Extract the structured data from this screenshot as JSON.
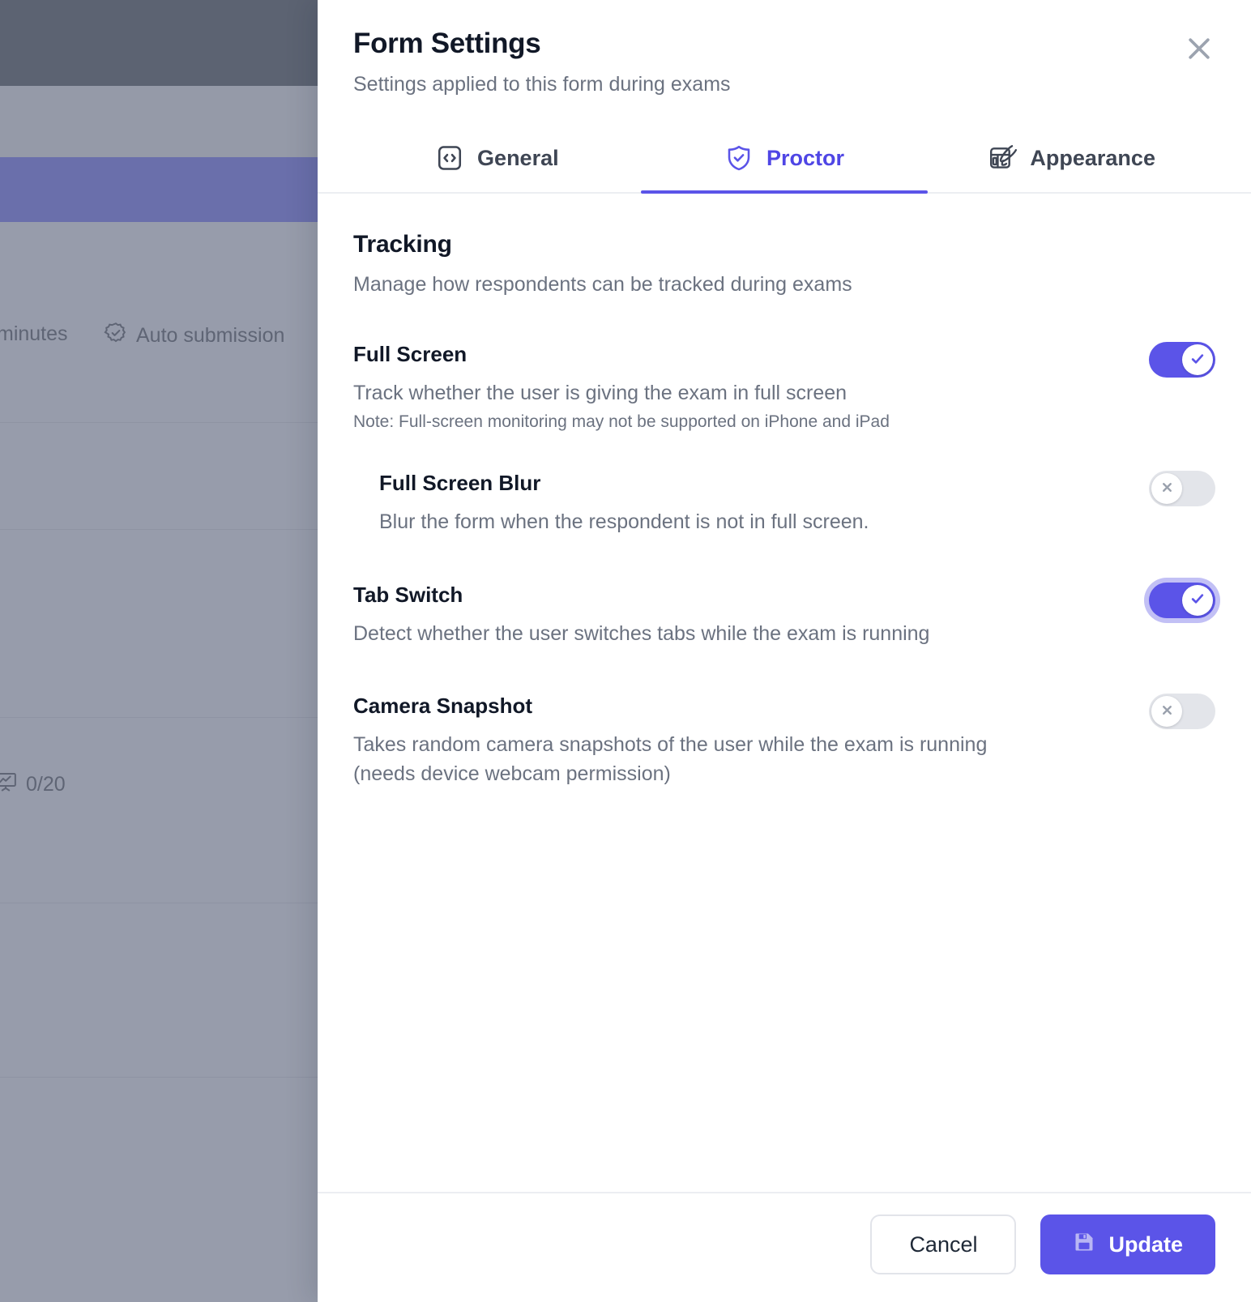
{
  "background": {
    "timer_text": "minutes",
    "auto_submission_label": "Auto submission",
    "auto_submission_icon": "check-badge-icon",
    "counter_text": "0/20",
    "counter_icon": "presentation-chart-icon"
  },
  "modal": {
    "title": "Form Settings",
    "subtitle": "Settings applied to this form during exams",
    "close_icon": "close-icon",
    "tabs": [
      {
        "label": "General",
        "icon": "code-square-icon",
        "active": false
      },
      {
        "label": "Proctor",
        "icon": "shield-check-icon",
        "active": true
      },
      {
        "label": "Appearance",
        "icon": "layout-brush-icon",
        "active": false
      }
    ],
    "section": {
      "title": "Tracking",
      "subtitle": "Manage how respondents can be tracked during exams"
    },
    "settings": [
      {
        "name": "Full Screen",
        "description": "Track whether the user is giving the exam in full screen",
        "note": "Note: Full-screen monitoring may not be supported on iPhone and iPad",
        "state": "on",
        "indented": false,
        "focused": false
      },
      {
        "name": "Full Screen Blur",
        "description": "Blur the form when the respondent is not in full screen.",
        "note": "",
        "state": "off",
        "indented": true,
        "focused": false
      },
      {
        "name": "Tab Switch",
        "description": "Detect whether the user switches tabs while the exam is running",
        "note": "",
        "state": "on",
        "indented": false,
        "focused": true
      },
      {
        "name": "Camera Snapshot",
        "description": "Takes random camera snapshots of the user while the exam is running (needs device webcam permission)",
        "note": "",
        "state": "off",
        "indented": false,
        "focused": false
      }
    ],
    "footer": {
      "cancel_label": "Cancel",
      "update_label": "Update",
      "update_icon": "save-floppy-icon"
    }
  },
  "colors": {
    "accent": "#5b54e8",
    "accent_text": "#4f46e5",
    "toggle_off": "#e3e5ea",
    "focus_ring": "#c2c0f5",
    "title": "#111827",
    "muted": "#6b7280"
  }
}
